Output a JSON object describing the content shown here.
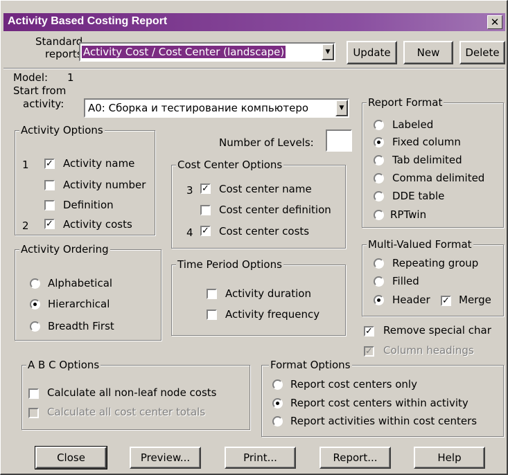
{
  "window": {
    "title": "Activity Based Costing Report",
    "close_glyph": "✕"
  },
  "top": {
    "standard_label_1": "Standard",
    "standard_label_2": "reports:",
    "selected_report": "Activity Cost / Cost Center (landscape)",
    "update_label": "Update",
    "new_label": "New",
    "delete_label": "Delete"
  },
  "model": {
    "label": "Model:",
    "value": "1"
  },
  "start": {
    "label_1": "Start from",
    "label_2": "activity:",
    "value": "A0:  Сборка и тестирование компьютеро"
  },
  "levels": {
    "label": "Number of Levels:",
    "value": ""
  },
  "activity_options": {
    "title": "Activity Options",
    "items": [
      {
        "order": "1",
        "label": "Activity name",
        "checked": true
      },
      {
        "order": "",
        "label": "Activity number",
        "checked": false
      },
      {
        "order": "",
        "label": "Definition",
        "checked": false
      },
      {
        "order": "2",
        "label": "Activity costs",
        "checked": true
      }
    ]
  },
  "cost_center_options": {
    "title": "Cost Center Options",
    "items": [
      {
        "order": "3",
        "label": "Cost center name",
        "checked": true
      },
      {
        "order": "",
        "label": "Cost center definition",
        "checked": false
      },
      {
        "order": "4",
        "label": "Cost center costs",
        "checked": true
      }
    ]
  },
  "activity_ordering": {
    "title": "Activity Ordering",
    "items": [
      {
        "label": "Alphabetical",
        "selected": false
      },
      {
        "label": "Hierarchical",
        "selected": true
      },
      {
        "label": "Breadth First",
        "selected": false
      }
    ]
  },
  "time_period_options": {
    "title": "Time Period Options",
    "items": [
      {
        "label": "Activity duration",
        "checked": false
      },
      {
        "label": "Activity frequency",
        "checked": false
      }
    ]
  },
  "report_format": {
    "title": "Report Format",
    "items": [
      {
        "label": "Labeled",
        "selected": false
      },
      {
        "label": "Fixed column",
        "selected": true
      },
      {
        "label": "Tab delimited",
        "selected": false
      },
      {
        "label": "Comma delimited",
        "selected": false
      },
      {
        "label": "DDE table",
        "selected": false
      },
      {
        "label": "RPTwin",
        "selected": false
      }
    ]
  },
  "multi_valued_format": {
    "title": "Multi-Valued Format",
    "items": [
      {
        "label": "Repeating group",
        "selected": false
      },
      {
        "label": "Filled",
        "selected": false
      },
      {
        "label": "Header",
        "selected": true
      }
    ],
    "merge_label": "Merge",
    "merge_checked": true
  },
  "extra": {
    "remove_special_label": "Remove special char",
    "remove_special_checked": true,
    "column_headings_label": "Column headings",
    "column_headings_checked": true
  },
  "abc_options": {
    "title": "A B C   Options",
    "calc_nonleaf_label": "Calculate all non-leaf node costs",
    "calc_totals_label": "Calculate all cost center totals"
  },
  "format_options": {
    "title": "Format Options",
    "items": [
      {
        "label": "Report cost centers only",
        "selected": false
      },
      {
        "label": "Report cost centers within activity",
        "selected": true
      },
      {
        "label": "Report activities within cost centers",
        "selected": false
      }
    ]
  },
  "buttons": {
    "close": "Close",
    "preview": "Preview...",
    "print": "Print...",
    "report": "Report...",
    "help": "Help"
  },
  "check_glyph": "✓"
}
